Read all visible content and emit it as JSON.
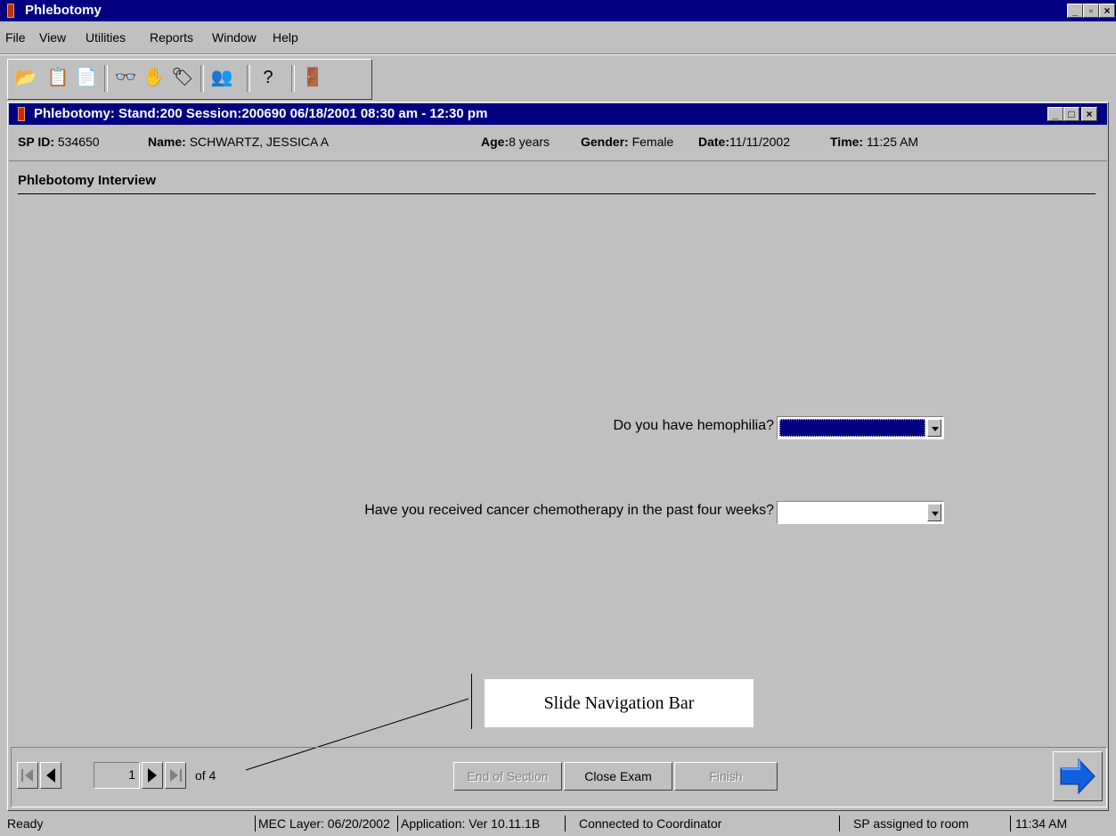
{
  "app": {
    "title": "Phlebotomy"
  },
  "menu": {
    "items": [
      {
        "label": "File"
      },
      {
        "label": "View"
      },
      {
        "label": "Utilities"
      },
      {
        "label": "Reports"
      },
      {
        "label": "Window"
      },
      {
        "label": "Help"
      }
    ]
  },
  "toolbar": {
    "icons": [
      "open-folder-icon",
      "clipboard-icon",
      "document-icon",
      "glasses-icon",
      "stop-hand-icon",
      "tag-icon",
      "people-icon",
      "help-icon",
      "exit-door-icon"
    ]
  },
  "child_window": {
    "title": "Phlebotomy: Stand:200 Session:200690 06/18/2001 08:30 am - 12:30 pm"
  },
  "info": {
    "sp_id_label": "SP ID:",
    "sp_id": "534650",
    "name_label": "Name:",
    "name": "SCHWARTZ, JESSICA A",
    "age_label": "Age:",
    "age": "8 years",
    "gender_label": "Gender:",
    "gender": "Female",
    "date_label": "Date:",
    "date": "11/11/2002",
    "time_label": "Time:",
    "time": "11:25 AM"
  },
  "section": {
    "title": "Phlebotomy Interview"
  },
  "questions": [
    {
      "label": "Do you have hemophilia?",
      "value": "",
      "selected": true
    },
    {
      "label": "Have you received cancer chemotherapy in the past four weeks?",
      "value": "",
      "selected": false
    }
  ],
  "callout": {
    "text": "Slide Navigation Bar"
  },
  "nav": {
    "page": "1",
    "of_text": "of 4",
    "buttons": {
      "end_of_section": "End of Section",
      "close_exam": "Close Exam",
      "finish": "Finish"
    }
  },
  "status": {
    "ready": "Ready",
    "mec_layer": "MEC Layer: 06/20/2002",
    "application": "Application: Ver 10.11.1B",
    "connection": "Connected to Coordinator",
    "sp_state": "SP assigned to room",
    "clock": "11:34 AM"
  },
  "colors": {
    "titlebar": "#000080",
    "face": "#c0c0c0",
    "selection": "#000080",
    "next_arrow": "#1060e0"
  }
}
